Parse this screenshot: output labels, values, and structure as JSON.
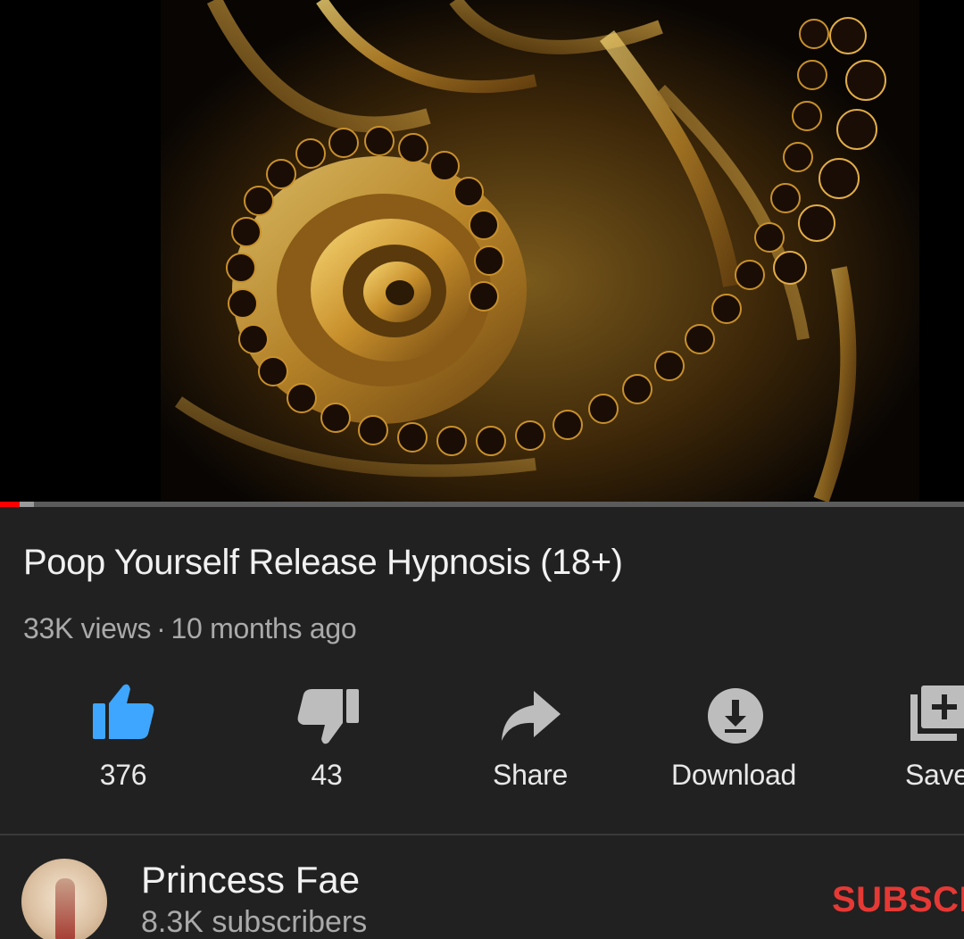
{
  "video": {
    "title": "Poop Yourself Release Hypnosis (18+)",
    "views": "33K views",
    "separator": "·",
    "age": "10 months ago",
    "progress_fraction": 0.02,
    "buffered_fraction": 0.035
  },
  "actions": [
    {
      "id": "like",
      "icon": "thumbs-up-icon",
      "label": "376",
      "active": true
    },
    {
      "id": "dislike",
      "icon": "thumbs-down-icon",
      "label": "43",
      "active": false
    },
    {
      "id": "share",
      "icon": "share-arrow-icon",
      "label": "Share",
      "active": false
    },
    {
      "id": "download",
      "icon": "download-icon",
      "label": "Download",
      "active": false
    },
    {
      "id": "save",
      "icon": "playlist-add-icon",
      "label": "Save",
      "active": false
    }
  ],
  "channel": {
    "name": "Princess Fae",
    "subscribers": "8.3K subscribers",
    "subscribe_label": "SUBSCRIBE"
  },
  "colors": {
    "background": "#212121",
    "accent_red": "#e53935",
    "like_active": "#3ea6ff",
    "text_primary": "#f1f1f1",
    "text_secondary": "#aaaaaa"
  }
}
